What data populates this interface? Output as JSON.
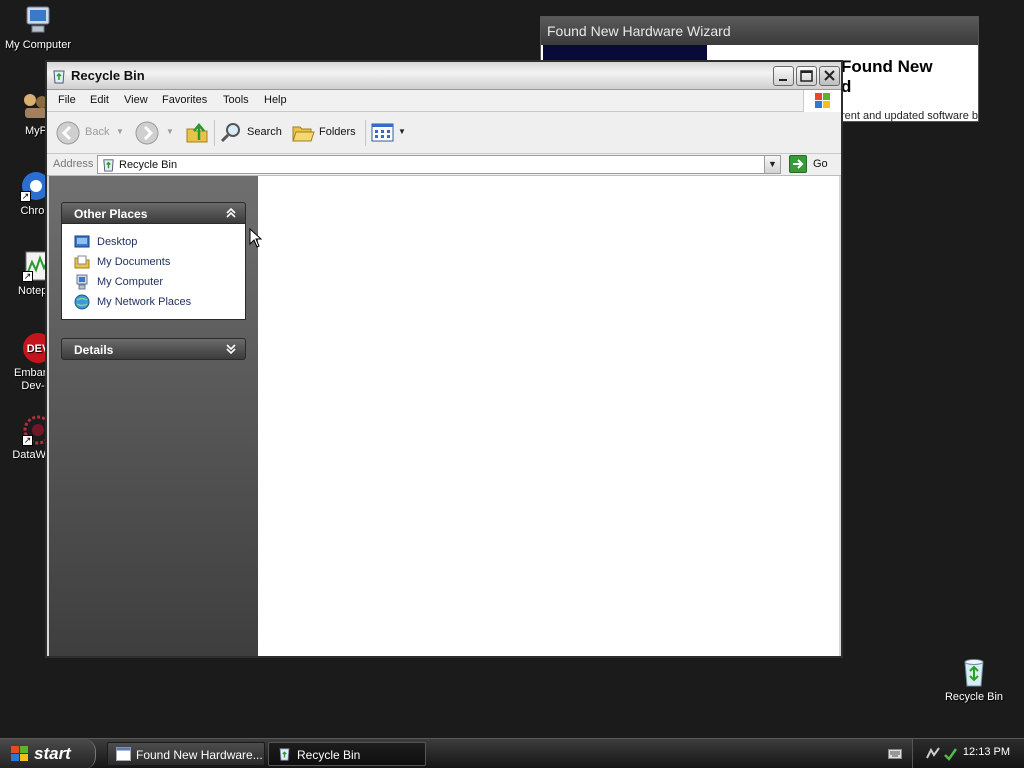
{
  "desktop": {
    "icons": [
      {
        "label": "My Computer",
        "icon": "my-computer-icon"
      },
      {
        "label": "MyPa",
        "icon": "mypal-icon"
      },
      {
        "label": "Chrom",
        "icon": "chrome-icon"
      },
      {
        "label": "Notepa",
        "icon": "notepad-icon"
      },
      {
        "label": "Embarca",
        "label2": "Dev-C",
        "icon": "embarcadero-devcpp-icon"
      },
      {
        "label": "DataWa",
        "icon": "datawa-icon"
      },
      {
        "label": "Recycle Bin",
        "icon": "recycle-bin-icon"
      }
    ]
  },
  "wizard": {
    "title": "Found New Hardware Wizard",
    "heading_line1": "Found New",
    "heading_line2": "d",
    "text": "rent and updated software b"
  },
  "window": {
    "title": "Recycle Bin",
    "menu": [
      "File",
      "Edit",
      "View",
      "Favorites",
      "Tools",
      "Help"
    ],
    "toolbar": {
      "back": "Back",
      "search": "Search",
      "folders": "Folders"
    },
    "address": {
      "label": "Address",
      "value": "Recycle Bin",
      "go": "Go"
    },
    "other_places": {
      "title": "Other Places",
      "items": [
        {
          "label": "Desktop",
          "icon": "desktop-icon"
        },
        {
          "label": "My Documents",
          "icon": "my-documents-icon"
        },
        {
          "label": "My Computer",
          "icon": "my-computer-icon"
        },
        {
          "label": "My Network Places",
          "icon": "network-places-icon"
        }
      ]
    },
    "details": {
      "title": "Details"
    }
  },
  "taskbar": {
    "start": "start",
    "tasks": [
      {
        "label": "Found New Hardware...",
        "active": false
      },
      {
        "label": "Recycle Bin",
        "active": true
      }
    ],
    "clock": "12:13 PM"
  }
}
